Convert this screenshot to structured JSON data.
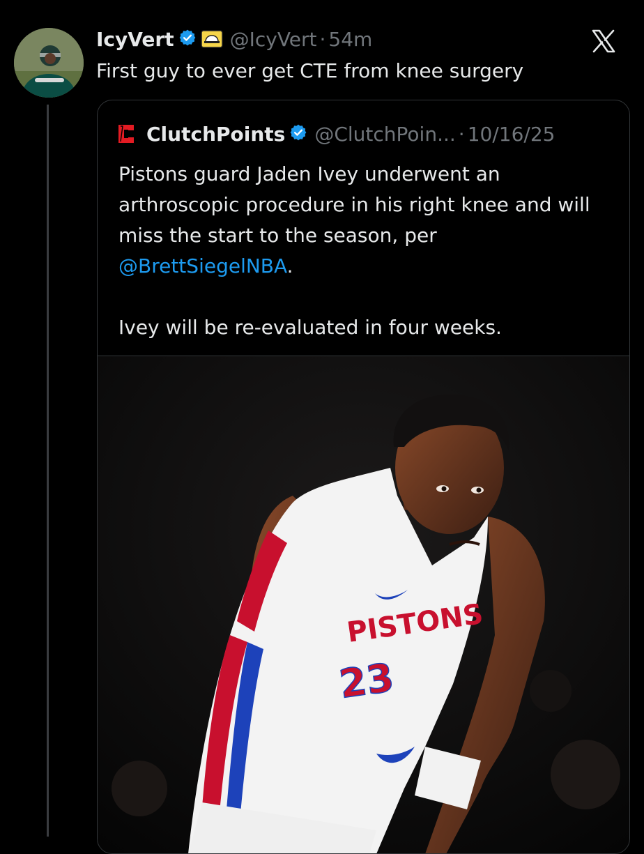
{
  "tweet": {
    "author_name": "IcyVert",
    "handle": "@IcyVert",
    "separator": "·",
    "time": "54m",
    "text": "First guy to ever get CTE from knee surgery",
    "icons": [
      "avatar",
      "verified-badge-icon",
      "affiliate-badge-icon",
      "x-logo-icon"
    ],
    "colors": {
      "background": "#000000",
      "text": "#e7e9ea",
      "muted": "#71767b",
      "link": "#1d9bf0",
      "verified": "#1d9bf0"
    }
  },
  "quoted_tweet": {
    "author_name": "ClutchPoints",
    "handle": "@ClutchPoin...",
    "separator": "·",
    "date": "10/16/25",
    "text_part1": "Pistons guard Jaden Ivey underwent an arthroscopic procedure in his right knee and will miss the start to the season, per ",
    "mention": "@BrettSiegelNBA",
    "text_part1_end": ".",
    "text_part2": "Ivey will be re-evaluated in four weeks.",
    "logo_color": "#e31b23",
    "photo": {
      "jersey_team": "PISTONS",
      "jersey_number": "23"
    }
  }
}
